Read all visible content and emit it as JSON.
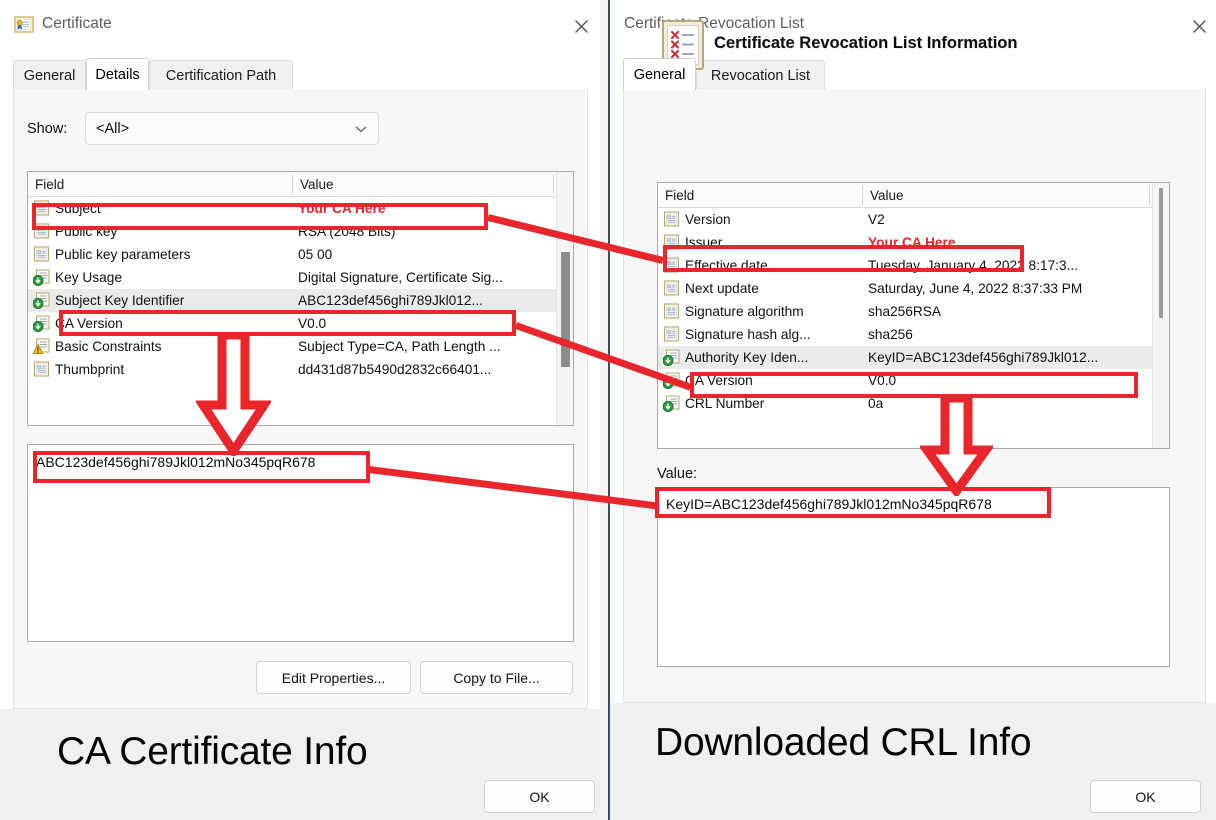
{
  "certificate_window": {
    "title": "Certificate",
    "title_icon": "certificate-icon",
    "close_icon": "close-icon",
    "tabs": [
      {
        "label": "General",
        "active": false
      },
      {
        "label": "Details",
        "active": true
      },
      {
        "label": "Certification Path",
        "active": false
      }
    ],
    "show": {
      "label": "Show:",
      "value": "<All>",
      "chevron_icon": "chevron-down-icon"
    },
    "field_list": {
      "columns": [
        "Field",
        "Value"
      ],
      "rows": [
        {
          "icon": "certificate-field-icon",
          "field": "Subject",
          "value": "Your CA Here",
          "selected": false,
          "value_red": true
        },
        {
          "icon": "certificate-field-icon",
          "field": "Public key",
          "value": "RSA (2048 Bits)",
          "selected": false,
          "value_red": false
        },
        {
          "icon": "certificate-field-icon",
          "field": "Public key parameters",
          "value": "05 00",
          "selected": false,
          "value_red": false
        },
        {
          "icon": "extension-field-icon",
          "field": "Key Usage",
          "value": "Digital Signature, Certificate Sig...",
          "selected": false,
          "value_red": false
        },
        {
          "icon": "extension-field-icon",
          "field": "Subject Key Identifier",
          "value": "ABC123def456ghi789Jkl012...",
          "selected": true,
          "value_red": false
        },
        {
          "icon": "extension-field-icon",
          "field": "CA Version",
          "value": "V0.0",
          "selected": false,
          "value_red": false
        },
        {
          "icon": "warning-field-icon",
          "field": "Basic Constraints",
          "value": "Subject Type=CA, Path Length ...",
          "selected": false,
          "value_red": false
        },
        {
          "icon": "certificate-field-icon",
          "field": "Thumbprint",
          "value": "dd431d87b5490d2832c66401...",
          "selected": false,
          "value_red": false
        }
      ]
    },
    "value_box_text": "ABC123def456ghi789Jkl012mNo345pqR678",
    "buttons": {
      "edit_properties": "Edit Properties...",
      "copy_to_file": "Copy to File...",
      "ok": "OK"
    }
  },
  "crl_window": {
    "title": "Certificate Revocation List",
    "close_icon": "close-icon",
    "tabs": [
      {
        "label": "General",
        "active": true
      },
      {
        "label": "Revocation List",
        "active": false
      }
    ],
    "info_heading": "Certificate Revocation List Information",
    "info_icon": "crl-icon",
    "field_list": {
      "columns": [
        "Field",
        "Value"
      ],
      "rows": [
        {
          "icon": "certificate-field-icon",
          "field": "Version",
          "value": "V2",
          "selected": false,
          "value_red": false
        },
        {
          "icon": "certificate-field-icon",
          "field": "Issuer",
          "value": "Your CA Here",
          "selected": false,
          "value_red": true
        },
        {
          "icon": "certificate-field-icon",
          "field": "Effective date",
          "value": "Tuesday, January 4, 2022 8:17:3...",
          "selected": false,
          "value_red": false
        },
        {
          "icon": "certificate-field-icon",
          "field": "Next update",
          "value": "Saturday, June 4, 2022 8:37:33 PM",
          "selected": false,
          "value_red": false
        },
        {
          "icon": "certificate-field-icon",
          "field": "Signature algorithm",
          "value": "sha256RSA",
          "selected": false,
          "value_red": false
        },
        {
          "icon": "certificate-field-icon",
          "field": "Signature hash alg...",
          "value": "sha256",
          "selected": false,
          "value_red": false
        },
        {
          "icon": "extension-field-icon",
          "field": "Authority Key Iden...",
          "value": "KeyID=ABC123def456ghi789Jkl012...",
          "selected": true,
          "value_red": false
        },
        {
          "icon": "extension-field-icon",
          "field": "CA Version",
          "value": "V0.0",
          "selected": false,
          "value_red": false
        },
        {
          "icon": "extension-field-icon",
          "field": "CRL Number",
          "value": "0a",
          "selected": false,
          "value_red": false
        }
      ]
    },
    "value_label": "Value:",
    "value_box_text": "KeyID=ABC123def456ghi789Jkl012mNo345pqR678",
    "buttons": {
      "ok": "OK"
    }
  },
  "annotations": {
    "left_caption": "CA Certificate Info",
    "right_caption": "Downloaded CRL Info",
    "highlight_color": "#e8262b",
    "red_text_color": "#e8262b"
  }
}
